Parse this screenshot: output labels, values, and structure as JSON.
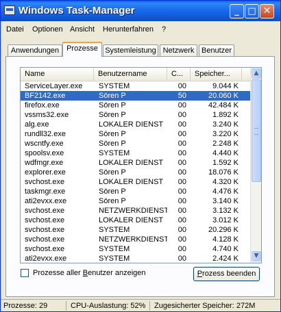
{
  "window": {
    "title": "Windows Task-Manager"
  },
  "menu": {
    "items": [
      "Datei",
      "Optionen",
      "Ansicht",
      "Herunterfahren",
      "?"
    ]
  },
  "tabs": [
    {
      "label": "Anwendungen",
      "active": false
    },
    {
      "label": "Prozesse",
      "active": true
    },
    {
      "label": "Systemleistung",
      "active": false
    },
    {
      "label": "Netzwerk",
      "active": false
    },
    {
      "label": "Benutzer",
      "active": false
    }
  ],
  "table": {
    "columns": [
      "Name",
      "Benutzername",
      "C...",
      "Speicher..."
    ],
    "rows": [
      {
        "name": "ServiceLayer.exe",
        "user": "SYSTEM",
        "cpu": "00",
        "mem": "9.044 K",
        "selected": false
      },
      {
        "name": "BF2142.exe",
        "user": "Sören P",
        "cpu": "50",
        "mem": "20.060 K",
        "selected": true
      },
      {
        "name": "firefox.exe",
        "user": "Sören P",
        "cpu": "00",
        "mem": "42.484 K",
        "selected": false
      },
      {
        "name": "vssms32.exe",
        "user": "Sören P",
        "cpu": "00",
        "mem": "1.892 K",
        "selected": false
      },
      {
        "name": "alg.exe",
        "user": "LOKALER DIENST",
        "cpu": "00",
        "mem": "3.240 K",
        "selected": false
      },
      {
        "name": "rundll32.exe",
        "user": "Sören P",
        "cpu": "00",
        "mem": "3.220 K",
        "selected": false
      },
      {
        "name": "wscntfy.exe",
        "user": "Sören P",
        "cpu": "00",
        "mem": "2.248 K",
        "selected": false
      },
      {
        "name": "spoolsv.exe",
        "user": "SYSTEM",
        "cpu": "00",
        "mem": "4.440 K",
        "selected": false
      },
      {
        "name": "wdfmgr.exe",
        "user": "LOKALER DIENST",
        "cpu": "00",
        "mem": "1.592 K",
        "selected": false
      },
      {
        "name": "explorer.exe",
        "user": "Sören P",
        "cpu": "00",
        "mem": "18.076 K",
        "selected": false
      },
      {
        "name": "svchost.exe",
        "user": "LOKALER DIENST",
        "cpu": "00",
        "mem": "4.320 K",
        "selected": false
      },
      {
        "name": "taskmgr.exe",
        "user": "Sören P",
        "cpu": "00",
        "mem": "4.476 K",
        "selected": false
      },
      {
        "name": "ati2evxx.exe",
        "user": "Sören P",
        "cpu": "00",
        "mem": "3.140 K",
        "selected": false
      },
      {
        "name": "svchost.exe",
        "user": "NETZWERKDIENST",
        "cpu": "00",
        "mem": "3.132 K",
        "selected": false
      },
      {
        "name": "svchost.exe",
        "user": "LOKALER DIENST",
        "cpu": "00",
        "mem": "3.012 K",
        "selected": false
      },
      {
        "name": "svchost.exe",
        "user": "SYSTEM",
        "cpu": "00",
        "mem": "20.296 K",
        "selected": false
      },
      {
        "name": "svchost.exe",
        "user": "NETZWERKDIENST",
        "cpu": "00",
        "mem": "4.128 K",
        "selected": false
      },
      {
        "name": "svchost.exe",
        "user": "SYSTEM",
        "cpu": "00",
        "mem": "4.740 K",
        "selected": false
      },
      {
        "name": "ati2evxx.exe",
        "user": "SYSTEM",
        "cpu": "00",
        "mem": "2.424 K",
        "selected": false
      }
    ]
  },
  "checkbox": {
    "label_prefix": "Prozesse aller ",
    "label_accel": "B",
    "label_suffix": "enutzer anzeigen",
    "checked": false
  },
  "end_button": {
    "label_accel": "P",
    "label_rest": "rozess beenden"
  },
  "status": {
    "processes": "Prozesse: 29",
    "cpu": "CPU-Auslastung: 52%",
    "commit": "Zugesicherter Speicher: 272M"
  }
}
